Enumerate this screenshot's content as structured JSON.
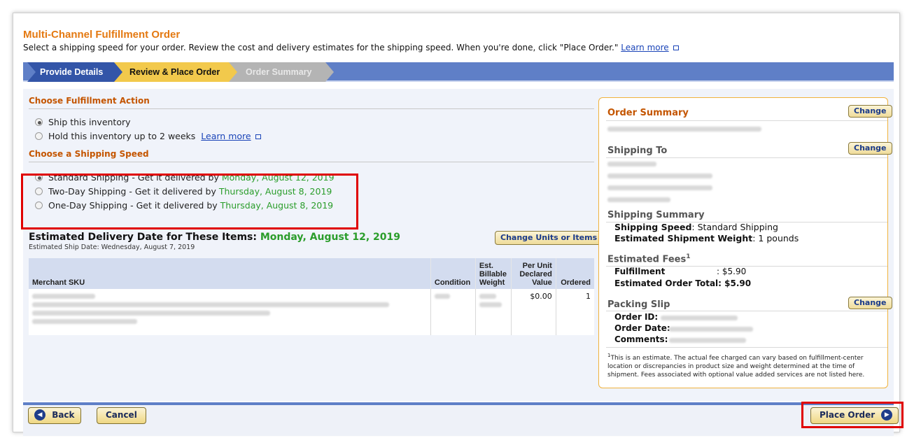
{
  "header": {
    "title": "Multi-Channel Fulfillment Order",
    "subtitle": "Select a shipping speed for your order. Review the cost and delivery estimates for the shipping speed. When you're done, click \"Place Order.\"",
    "learn_more": "Learn more"
  },
  "steps": [
    {
      "label": "Provide Details",
      "state": "done"
    },
    {
      "label": "Review & Place Order",
      "state": "current"
    },
    {
      "label": "Order Summary",
      "state": "pending"
    }
  ],
  "fulfillment_action": {
    "heading": "Choose Fulfillment Action",
    "options": [
      {
        "label": "Ship this inventory",
        "selected": true
      },
      {
        "label": "Hold this inventory up to 2 weeks",
        "link": "Learn more",
        "selected": false
      }
    ]
  },
  "shipping_speed": {
    "heading": "Choose a Shipping Speed",
    "options": [
      {
        "label": "Standard Shipping - Get it delivered by ",
        "date": "Monday, August 12, 2019",
        "selected": true
      },
      {
        "label": "Two-Day Shipping - Get it delivered by ",
        "date": "Thursday, August 8, 2019",
        "selected": false
      },
      {
        "label": "One-Day Shipping - Get it delivered by ",
        "date": "Thursday, August 8, 2019",
        "selected": false
      }
    ]
  },
  "delivery": {
    "label": "Estimated Delivery Date for These Items: ",
    "date": "Monday, August 12, 2019",
    "ship_date": "Estimated Ship Date: Wednesday, August 7, 2019",
    "change_button": "Change Units or Items"
  },
  "table": {
    "headers": {
      "sku": "Merchant SKU",
      "condition": "Condition",
      "weight_1": "Est.",
      "weight_2": "Billable",
      "weight_3": "Weight",
      "value_1": "Per Unit",
      "value_2": "Declared",
      "value_3": "Value",
      "ordered": "Ordered"
    },
    "row": {
      "declared_value": "$0.00",
      "ordered": "1"
    }
  },
  "summary": {
    "order_summary": "Order Summary",
    "change": "Change",
    "shipping_to": "Shipping To",
    "shipping_summary": "Shipping Summary",
    "speed_label": "Shipping Speed",
    "speed_value": ": Standard Shipping",
    "weight_label": "Estimated Shipment Weight",
    "weight_value": ": 1 pounds",
    "fees_heading": "Estimated Fees",
    "fees_sup": "1",
    "fulfillment_label": "Fulfillment",
    "fulfillment_value": ": $5.90",
    "total_label": "Estimated Order Total",
    "total_value": ": $5.90",
    "packing_slip": "Packing Slip",
    "order_id_label": "Order ID:",
    "order_date_label": "Order Date:",
    "comments_label": "Comments:",
    "footnote_sup": "1",
    "footnote": "This is an estimate. The actual fee charged can vary based on fulfillment-center location or discrepancies in product size and weight determined at the time of shipment. Fees associated with optional value added services are not listed here."
  },
  "footer": {
    "back": "Back",
    "cancel": "Cancel",
    "place_order": "Place Order"
  },
  "colors": {
    "accent_orange": "#e47911",
    "date_green": "#2a9d2a",
    "step_bar_blue": "#5f7fc7",
    "highlight_red": "#e00000"
  }
}
